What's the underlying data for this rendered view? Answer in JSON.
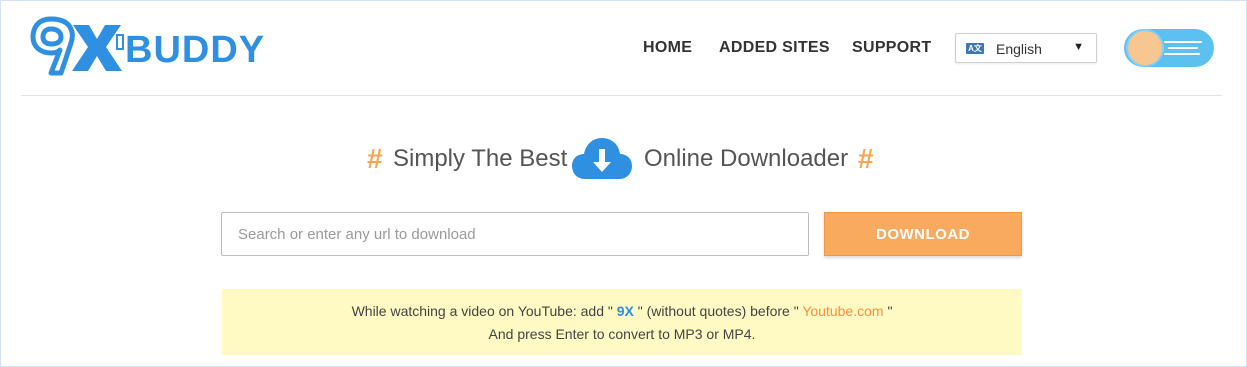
{
  "logo": {
    "text": "9XBUDDY",
    "colors": {
      "blue": "#2f8fe0",
      "white": "#ffffff"
    }
  },
  "nav": {
    "home": "HOME",
    "added_sites": "ADDED SITES",
    "support": "SUPPORT"
  },
  "language": {
    "icon": "translate-icon",
    "icon_text": "A文",
    "selected": "English",
    "chevron": "⌄"
  },
  "theme_toggle": {
    "icon": "rocket-toggle-icon",
    "accent": "#5cc0f0"
  },
  "tagline": {
    "hash_left": "#",
    "left_text": "Simply The Best",
    "icon": "cloud-download-icon",
    "right_text": "Online Downloader",
    "hash_right": "#"
  },
  "search": {
    "placeholder": "Search or enter any url to download",
    "value": ""
  },
  "download_button": {
    "label": "DOWNLOAD",
    "color": "#f9aa5e"
  },
  "notice": {
    "line1_prefix": "While watching a video on YouTube: add \"",
    "highlight_9x": "9X",
    "line1_middle": "\" (without quotes) before \"",
    "highlight_youtube": "Youtube.com",
    "line1_suffix": "\"",
    "line2": "And press Enter to convert to MP3 or MP4.",
    "background": "#fff9c4"
  }
}
